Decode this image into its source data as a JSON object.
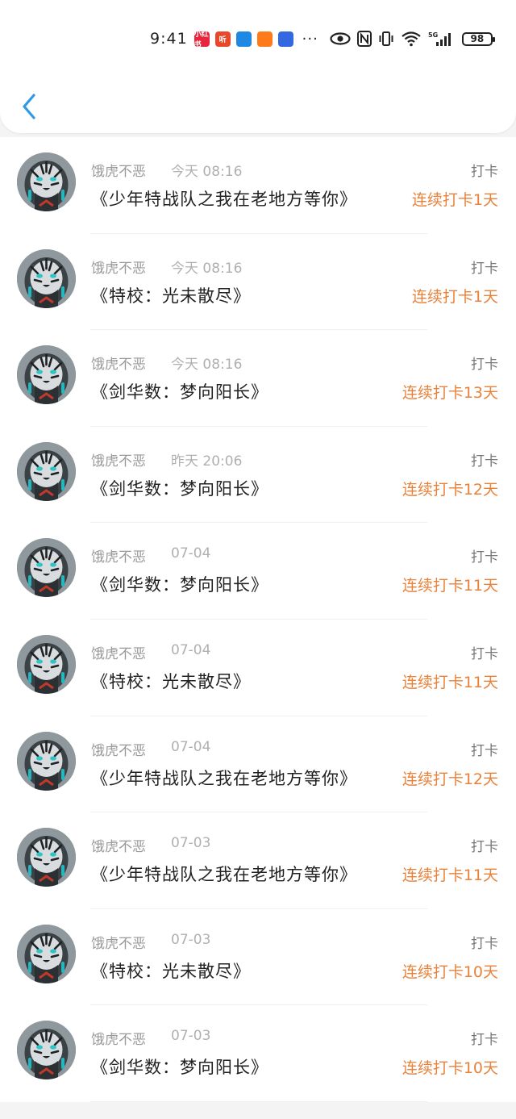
{
  "status_bar": {
    "time": "9:41",
    "apps": [
      {
        "name": "xiaohongshu-icon",
        "color": "#e8253c",
        "text": "小红书"
      },
      {
        "name": "ting-icon",
        "color": "#e8472a",
        "text": "听"
      },
      {
        "name": "app-blue-icon",
        "color": "#1e88e5",
        "text": ""
      },
      {
        "name": "app-orange-icon",
        "color": "#ff7a1a",
        "text": ""
      },
      {
        "name": "baidu-icon",
        "color": "#3468e0",
        "text": ""
      }
    ],
    "dots": "···",
    "battery": "98"
  },
  "colors": {
    "accent": "#e8823a",
    "back": "#2f9be8"
  },
  "records": [
    {
      "user": "饿虎不恶",
      "time": "今天 08:16",
      "tag": "打卡",
      "title": "《少年特战队之我在老地方等你》",
      "streak": "连续打卡1天"
    },
    {
      "user": "饿虎不恶",
      "time": "今天 08:16",
      "tag": "打卡",
      "title": "《特校：光未散尽》",
      "streak": "连续打卡1天"
    },
    {
      "user": "饿虎不恶",
      "time": "今天 08:16",
      "tag": "打卡",
      "title": "《剑华数：梦向阳长》",
      "streak": "连续打卡13天"
    },
    {
      "user": "饿虎不恶",
      "time": "昨天 20:06",
      "tag": "打卡",
      "title": "《剑华数：梦向阳长》",
      "streak": "连续打卡12天"
    },
    {
      "user": "饿虎不恶",
      "time": "07-04",
      "tag": "打卡",
      "title": "《剑华数：梦向阳长》",
      "streak": "连续打卡11天"
    },
    {
      "user": "饿虎不恶",
      "time": "07-04",
      "tag": "打卡",
      "title": "《特校：光未散尽》",
      "streak": "连续打卡11天"
    },
    {
      "user": "饿虎不恶",
      "time": "07-04",
      "tag": "打卡",
      "title": "《少年特战队之我在老地方等你》",
      "streak": "连续打卡12天"
    },
    {
      "user": "饿虎不恶",
      "time": "07-03",
      "tag": "打卡",
      "title": "《少年特战队之我在老地方等你》",
      "streak": "连续打卡11天"
    },
    {
      "user": "饿虎不恶",
      "time": "07-03",
      "tag": "打卡",
      "title": "《特校：光未散尽》",
      "streak": "连续打卡10天"
    },
    {
      "user": "饿虎不恶",
      "time": "07-03",
      "tag": "打卡",
      "title": "《剑华数：梦向阳长》",
      "streak": "连续打卡10天"
    }
  ]
}
